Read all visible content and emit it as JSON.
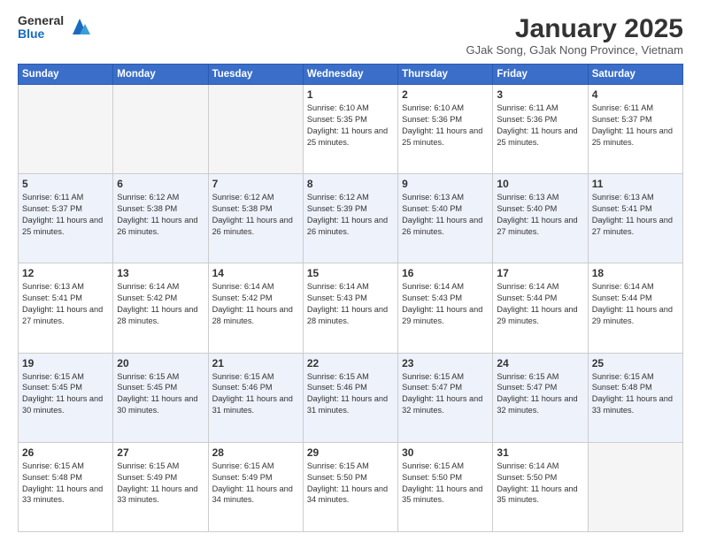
{
  "logo": {
    "general": "General",
    "blue": "Blue"
  },
  "header": {
    "title": "January 2025",
    "subtitle": "GJak Song, GJak Nong Province, Vietnam"
  },
  "days_of_week": [
    "Sunday",
    "Monday",
    "Tuesday",
    "Wednesday",
    "Thursday",
    "Friday",
    "Saturday"
  ],
  "weeks": [
    [
      {
        "day": "",
        "empty": true
      },
      {
        "day": "",
        "empty": true
      },
      {
        "day": "",
        "empty": true
      },
      {
        "day": "1",
        "sunrise": "6:10 AM",
        "sunset": "5:35 PM",
        "daylight": "11 hours and 25 minutes."
      },
      {
        "day": "2",
        "sunrise": "6:10 AM",
        "sunset": "5:36 PM",
        "daylight": "11 hours and 25 minutes."
      },
      {
        "day": "3",
        "sunrise": "6:11 AM",
        "sunset": "5:36 PM",
        "daylight": "11 hours and 25 minutes."
      },
      {
        "day": "4",
        "sunrise": "6:11 AM",
        "sunset": "5:37 PM",
        "daylight": "11 hours and 25 minutes."
      }
    ],
    [
      {
        "day": "5",
        "sunrise": "6:11 AM",
        "sunset": "5:37 PM",
        "daylight": "11 hours and 25 minutes."
      },
      {
        "day": "6",
        "sunrise": "6:12 AM",
        "sunset": "5:38 PM",
        "daylight": "11 hours and 26 minutes."
      },
      {
        "day": "7",
        "sunrise": "6:12 AM",
        "sunset": "5:38 PM",
        "daylight": "11 hours and 26 minutes."
      },
      {
        "day": "8",
        "sunrise": "6:12 AM",
        "sunset": "5:39 PM",
        "daylight": "11 hours and 26 minutes."
      },
      {
        "day": "9",
        "sunrise": "6:13 AM",
        "sunset": "5:40 PM",
        "daylight": "11 hours and 26 minutes."
      },
      {
        "day": "10",
        "sunrise": "6:13 AM",
        "sunset": "5:40 PM",
        "daylight": "11 hours and 27 minutes."
      },
      {
        "day": "11",
        "sunrise": "6:13 AM",
        "sunset": "5:41 PM",
        "daylight": "11 hours and 27 minutes."
      }
    ],
    [
      {
        "day": "12",
        "sunrise": "6:13 AM",
        "sunset": "5:41 PM",
        "daylight": "11 hours and 27 minutes."
      },
      {
        "day": "13",
        "sunrise": "6:14 AM",
        "sunset": "5:42 PM",
        "daylight": "11 hours and 28 minutes."
      },
      {
        "day": "14",
        "sunrise": "6:14 AM",
        "sunset": "5:42 PM",
        "daylight": "11 hours and 28 minutes."
      },
      {
        "day": "15",
        "sunrise": "6:14 AM",
        "sunset": "5:43 PM",
        "daylight": "11 hours and 28 minutes."
      },
      {
        "day": "16",
        "sunrise": "6:14 AM",
        "sunset": "5:43 PM",
        "daylight": "11 hours and 29 minutes."
      },
      {
        "day": "17",
        "sunrise": "6:14 AM",
        "sunset": "5:44 PM",
        "daylight": "11 hours and 29 minutes."
      },
      {
        "day": "18",
        "sunrise": "6:14 AM",
        "sunset": "5:44 PM",
        "daylight": "11 hours and 29 minutes."
      }
    ],
    [
      {
        "day": "19",
        "sunrise": "6:15 AM",
        "sunset": "5:45 PM",
        "daylight": "11 hours and 30 minutes."
      },
      {
        "day": "20",
        "sunrise": "6:15 AM",
        "sunset": "5:45 PM",
        "daylight": "11 hours and 30 minutes."
      },
      {
        "day": "21",
        "sunrise": "6:15 AM",
        "sunset": "5:46 PM",
        "daylight": "11 hours and 31 minutes."
      },
      {
        "day": "22",
        "sunrise": "6:15 AM",
        "sunset": "5:46 PM",
        "daylight": "11 hours and 31 minutes."
      },
      {
        "day": "23",
        "sunrise": "6:15 AM",
        "sunset": "5:47 PM",
        "daylight": "11 hours and 32 minutes."
      },
      {
        "day": "24",
        "sunrise": "6:15 AM",
        "sunset": "5:47 PM",
        "daylight": "11 hours and 32 minutes."
      },
      {
        "day": "25",
        "sunrise": "6:15 AM",
        "sunset": "5:48 PM",
        "daylight": "11 hours and 33 minutes."
      }
    ],
    [
      {
        "day": "26",
        "sunrise": "6:15 AM",
        "sunset": "5:48 PM",
        "daylight": "11 hours and 33 minutes."
      },
      {
        "day": "27",
        "sunrise": "6:15 AM",
        "sunset": "5:49 PM",
        "daylight": "11 hours and 33 minutes."
      },
      {
        "day": "28",
        "sunrise": "6:15 AM",
        "sunset": "5:49 PM",
        "daylight": "11 hours and 34 minutes."
      },
      {
        "day": "29",
        "sunrise": "6:15 AM",
        "sunset": "5:50 PM",
        "daylight": "11 hours and 34 minutes."
      },
      {
        "day": "30",
        "sunrise": "6:15 AM",
        "sunset": "5:50 PM",
        "daylight": "11 hours and 35 minutes."
      },
      {
        "day": "31",
        "sunrise": "6:14 AM",
        "sunset": "5:50 PM",
        "daylight": "11 hours and 35 minutes."
      },
      {
        "day": "",
        "empty": true
      }
    ]
  ]
}
